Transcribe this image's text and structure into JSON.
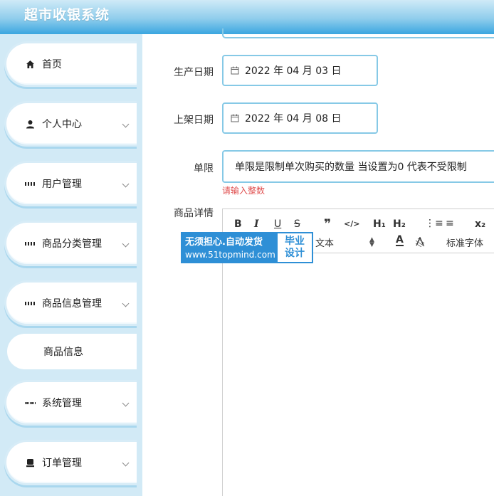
{
  "app": {
    "title": "超市收银系统"
  },
  "sidebar": {
    "items": [
      {
        "label": "首页",
        "icon": "home-icon"
      },
      {
        "label": "个人中心",
        "icon": "user-icon"
      },
      {
        "label": "用户管理",
        "icon": "grid-icon"
      },
      {
        "label": "商品分类管理",
        "icon": "grid-icon"
      },
      {
        "label": "商品信息管理",
        "icon": "grid-icon"
      },
      {
        "label": "系统管理",
        "icon": "apps-icon"
      },
      {
        "label": "订单管理",
        "icon": "order-icon"
      }
    ],
    "sub_item": {
      "label": "商品信息"
    }
  },
  "form": {
    "production_date": {
      "label": "生产日期",
      "value": "2022 年 04 月 03 日"
    },
    "listing_date": {
      "label": "上架日期",
      "value": "2022 年 04 月 08 日"
    },
    "limit": {
      "label": "单限",
      "value": "单限是限制单次购买的数量 当设置为0 代表不受限制",
      "error": "请输入整数"
    },
    "detail": {
      "label": "商品详情"
    }
  },
  "editor": {
    "toolbar": {
      "bold": "B",
      "italic": "I",
      "underline": "U",
      "strike": "S",
      "quote": "❞",
      "code": "</>",
      "h1": "H₁",
      "h2": "H₂",
      "ordered_list": "⋮≡",
      "bullet_list": "≡",
      "subscript": "x₂",
      "size_label": "文本",
      "font_color": "A",
      "font_label": "标准字体"
    }
  },
  "watermark": {
    "line1": "无须担心.自动发货",
    "line2": "www.51topmind.com",
    "badge1": "毕业",
    "badge2": "设计"
  }
}
